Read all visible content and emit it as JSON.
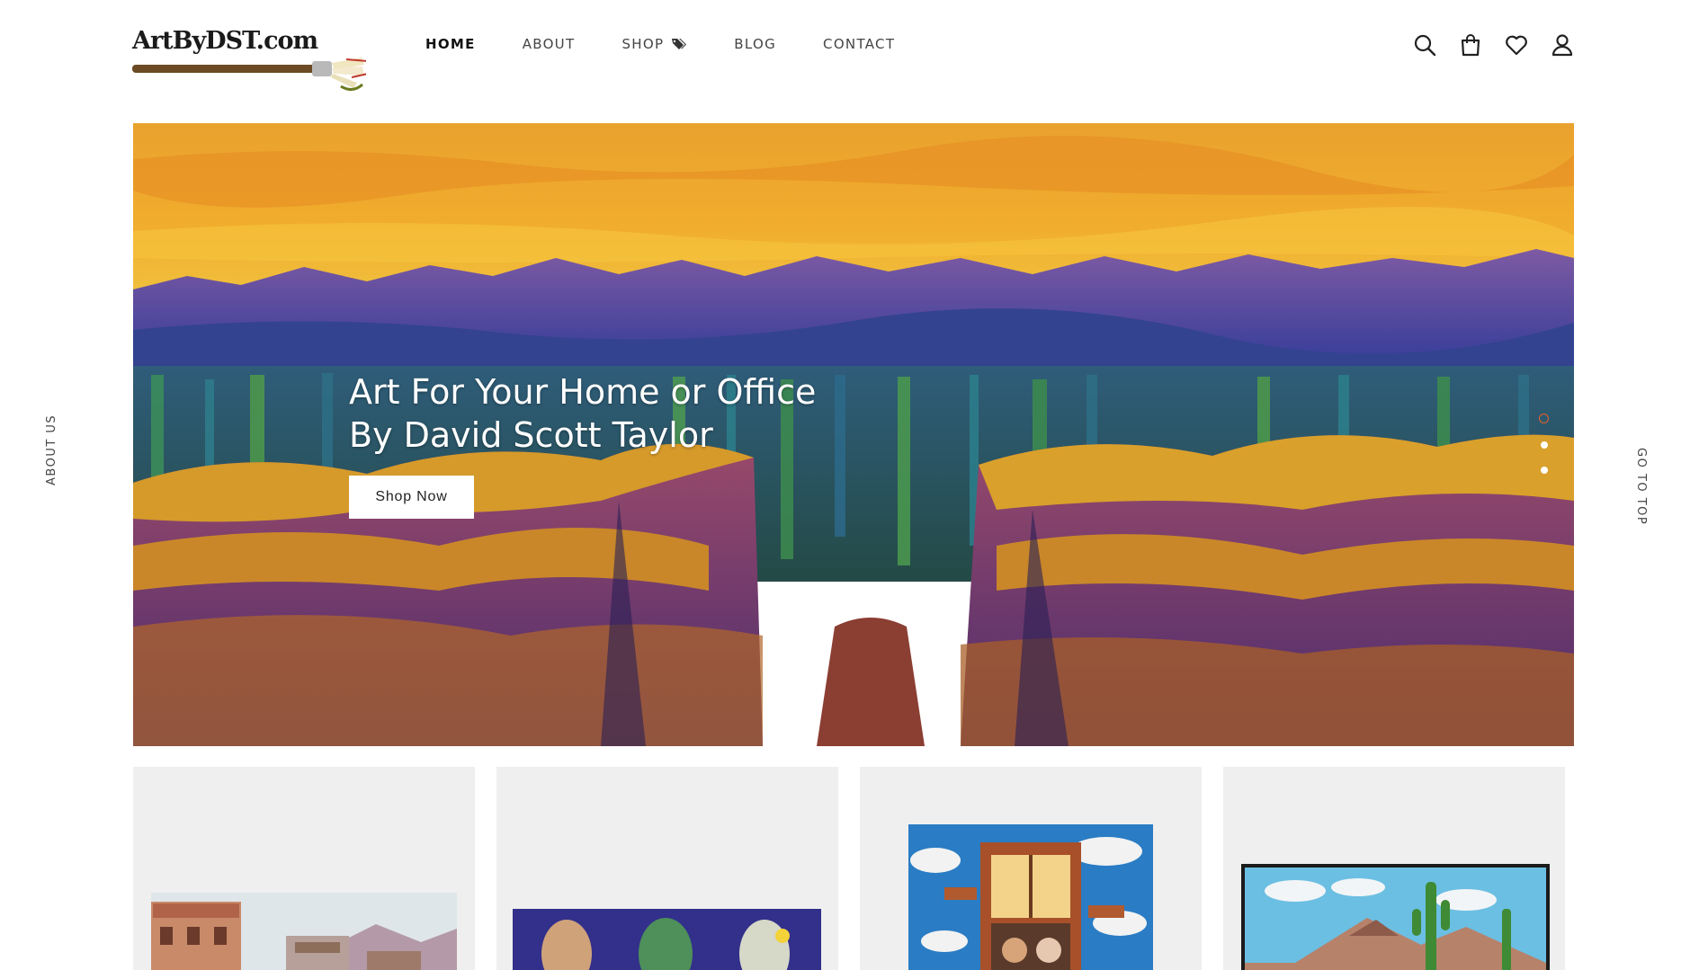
{
  "brand": {
    "logo_text": "ArtByDST.com"
  },
  "nav": {
    "items": [
      {
        "label": "HOME"
      },
      {
        "label": "ABOUT"
      },
      {
        "label": "SHOP"
      },
      {
        "label": "BLOG"
      },
      {
        "label": "CONTACT"
      }
    ]
  },
  "header_icons": [
    "search-icon",
    "shopping-bag-icon",
    "heart-icon",
    "user-icon"
  ],
  "side": {
    "left_label": "ABOUT US",
    "right_label": "GO TO TOP"
  },
  "hero": {
    "title_line1": "Art For Your Home or Office",
    "title_line2": "By David Scott Taylor",
    "button_label": "Shop Now",
    "slides_total": 3,
    "active_slide": 1
  },
  "products": [
    {
      "name": "hotel-livery-painting"
    },
    {
      "name": "three-faces-painting"
    },
    {
      "name": "window-couple-painting"
    },
    {
      "name": "desert-saguaro-painting"
    }
  ],
  "colors": {
    "accent": "#e4602b",
    "card_bg": "#efefef",
    "text_dark": "#222222"
  }
}
